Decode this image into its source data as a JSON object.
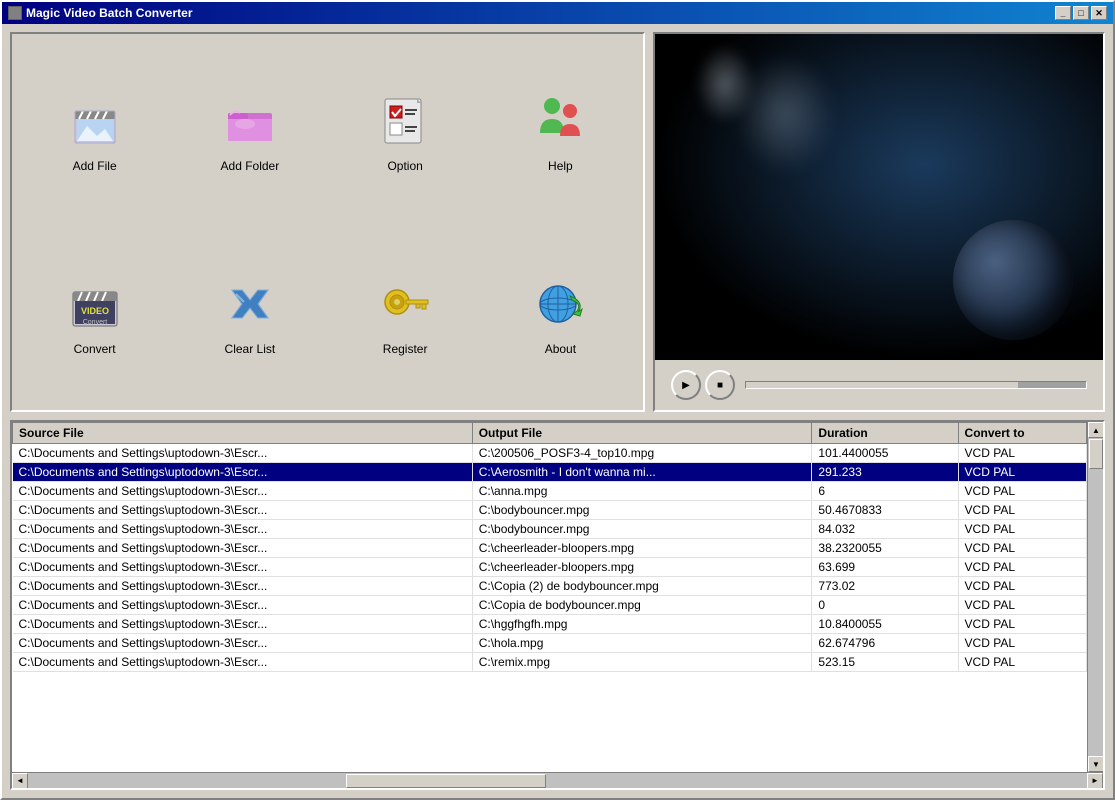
{
  "window": {
    "title": "Magic Video Batch Converter",
    "min_label": "_",
    "max_label": "□",
    "close_label": "✕"
  },
  "toolbar": {
    "buttons": [
      {
        "id": "add-file",
        "label": "Add File"
      },
      {
        "id": "add-folder",
        "label": "Add Folder"
      },
      {
        "id": "option",
        "label": "Option"
      },
      {
        "id": "help",
        "label": "Help"
      },
      {
        "id": "convert",
        "label": "Convert"
      },
      {
        "id": "clear-list",
        "label": "Clear List"
      },
      {
        "id": "register",
        "label": "Register"
      },
      {
        "id": "about",
        "label": "About"
      }
    ]
  },
  "controls": {
    "play_label": "▶",
    "stop_label": "■"
  },
  "table": {
    "columns": [
      "Source File",
      "Output File",
      "Duration",
      "Convert to"
    ],
    "rows": [
      {
        "source": "C:\\Documents and Settings\\uptodown-3\\Escr...",
        "output": "C:\\200506_POSF3-4_top10.mpg",
        "duration": "101.4400055",
        "convert": "VCD PAL"
      },
      {
        "source": "C:\\Documents and Settings\\uptodown-3\\Escr...",
        "output": "C:\\Aerosmith - I don't wanna mi...",
        "duration": "291.233",
        "convert": "VCD PAL"
      },
      {
        "source": "C:\\Documents and Settings\\uptodown-3\\Escr...",
        "output": "C:\\anna.mpg",
        "duration": "6",
        "convert": "VCD PAL"
      },
      {
        "source": "C:\\Documents and Settings\\uptodown-3\\Escr...",
        "output": "C:\\bodybouncer.mpg",
        "duration": "50.4670833",
        "convert": "VCD PAL"
      },
      {
        "source": "C:\\Documents and Settings\\uptodown-3\\Escr...",
        "output": "C:\\bodybouncer.mpg",
        "duration": "84.032",
        "convert": "VCD PAL"
      },
      {
        "source": "C:\\Documents and Settings\\uptodown-3\\Escr...",
        "output": "C:\\cheerleader-bloopers.mpg",
        "duration": "38.2320055",
        "convert": "VCD PAL"
      },
      {
        "source": "C:\\Documents and Settings\\uptodown-3\\Escr...",
        "output": "C:\\cheerleader-bloopers.mpg",
        "duration": "63.699",
        "convert": "VCD PAL"
      },
      {
        "source": "C:\\Documents and Settings\\uptodown-3\\Escr...",
        "output": "C:\\Copia (2) de bodybouncer.mpg",
        "duration": "773.02",
        "convert": "VCD PAL"
      },
      {
        "source": "C:\\Documents and Settings\\uptodown-3\\Escr...",
        "output": "C:\\Copia de bodybouncer.mpg",
        "duration": "0",
        "convert": "VCD PAL"
      },
      {
        "source": "C:\\Documents and Settings\\uptodown-3\\Escr...",
        "output": "C:\\hggfhgfh.mpg",
        "duration": "10.8400055",
        "convert": "VCD PAL"
      },
      {
        "source": "C:\\Documents and Settings\\uptodown-3\\Escr...",
        "output": "C:\\hola.mpg",
        "duration": "62.674796",
        "convert": "VCD PAL"
      },
      {
        "source": "C:\\Documents and Settings\\uptodown-3\\Escr...",
        "output": "C:\\remix.mpg",
        "duration": "523.15",
        "convert": "VCD PAL"
      }
    ]
  }
}
